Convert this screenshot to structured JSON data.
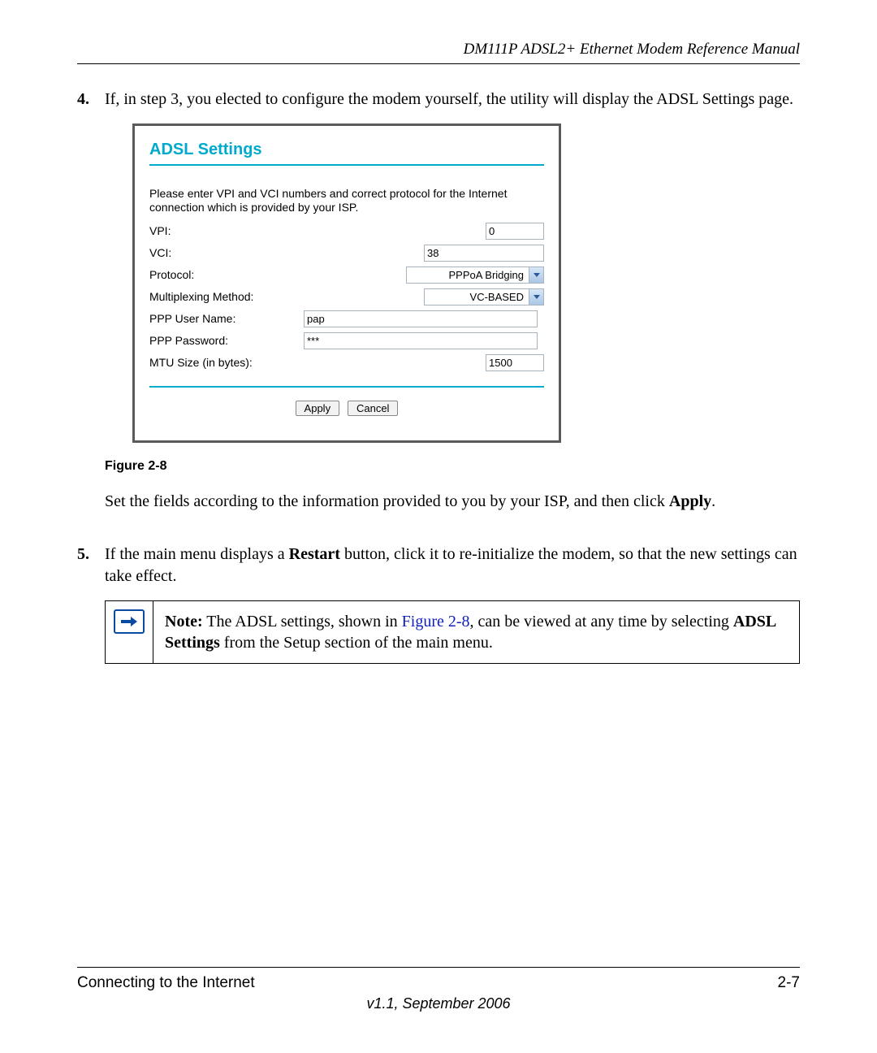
{
  "header": {
    "title": "DM111P ADSL2+ Ethernet Modem Reference Manual"
  },
  "steps": {
    "s4": {
      "num": "4.",
      "text_a": "If, in step 3, you elected to configure the modem yourself, the utility will display the ADSL Settings page."
    },
    "s5": {
      "num": "5.",
      "text_a": "If the main menu displays a ",
      "restart": "Restart",
      "text_b": " button, click it to re-initialize the modem, so that the new settings can take effect."
    }
  },
  "figure": {
    "caption": "Figure 2-8",
    "after_text_a": "Set the fields according to the information provided to you by your ISP, and then click ",
    "apply_word": "Apply",
    "after_text_b": "."
  },
  "adsl": {
    "title": "ADSL Settings",
    "instruction": "Please enter VPI and VCI numbers and correct protocol for the Internet connection which is provided by your ISP.",
    "labels": {
      "vpi": "VPI:",
      "vci": "VCI:",
      "protocol": "Protocol:",
      "mux": "Multiplexing Method:",
      "ppp_user": "PPP User Name:",
      "ppp_pass": "PPP Password:",
      "mtu": "MTU Size (in bytes):"
    },
    "values": {
      "vpi": "0",
      "vci": "38",
      "protocol": "PPPoA Bridging",
      "mux": "VC-BASED",
      "ppp_user": "pap",
      "ppp_pass": "***",
      "mtu": "1500"
    },
    "buttons": {
      "apply": "Apply",
      "cancel": "Cancel"
    }
  },
  "note": {
    "prefix": "Note:",
    "text_a": " The ADSL settings, shown in ",
    "link": "Figure 2-8",
    "text_b": ", can be viewed at any time by selecting ",
    "bold": "ADSL Settings",
    "text_c": " from the Setup section of the main menu."
  },
  "footer": {
    "chapter": "Connecting to the Internet",
    "page": "2-7",
    "version": "v1.1, September 2006"
  }
}
